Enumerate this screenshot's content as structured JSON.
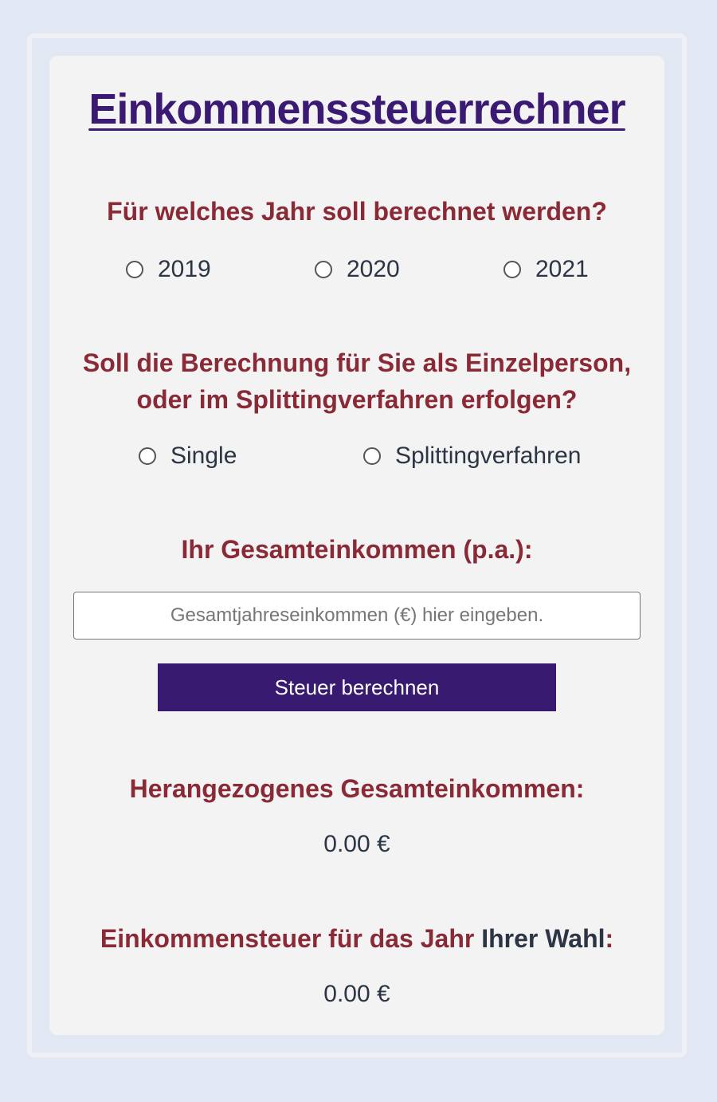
{
  "title": "Einkommenssteuerrechner",
  "year_question": "Für welches Jahr soll berechnet werden?",
  "year_options": [
    "2019",
    "2020",
    "2021"
  ],
  "mode_question_line1": "Soll die Berechnung für Sie als Einzelperson,",
  "mode_question_line2": "oder im Splittingverfahren erfolgen?",
  "mode_options": [
    "Single",
    "Splittingverfahren"
  ],
  "income_label": "Ihr Gesamteinkommen (p.a.):",
  "income_input": {
    "value": "",
    "placeholder": "Gesamtjahreseinkommen (€) hier eingeben."
  },
  "calc_button_label": "Steuer berechnen",
  "result_income_label": "Herangezogenes Gesamteinkommen:",
  "result_income_value": "0.00 €",
  "result_tax_label_part1": "Einkommensteuer für das Jahr ",
  "result_tax_label_part2": "Ihrer Wahl",
  "result_tax_label_part3": ":",
  "result_tax_value": "0.00 €",
  "colors": {
    "background": "#e1e7f3",
    "card": "#f3f3f4",
    "title": "#3b1a73",
    "question": "#8a2a36",
    "text": "#2b3544",
    "button": "#381a70"
  }
}
